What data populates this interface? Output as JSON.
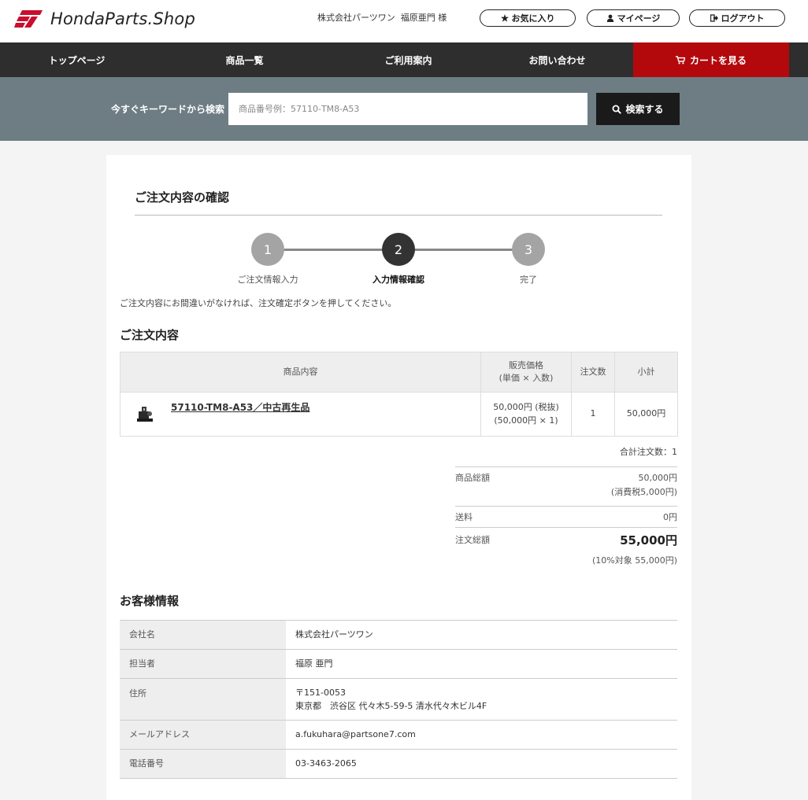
{
  "header": {
    "logo_text": "HondaParts.Shop",
    "user_company": "株式会社パーツワン",
    "user_name": "福原亜門",
    "user_suffix": "様",
    "favorites_label": "お気に入り",
    "mypage_label": "マイページ",
    "logout_label": "ログアウト"
  },
  "nav": {
    "items": [
      "トップページ",
      "商品一覧",
      "ご利用案内",
      "お問い合わせ"
    ],
    "cart_label": "カートを見る"
  },
  "search": {
    "label": "今すぐキーワードから検索",
    "placeholder": "商品番号例：57110-TM8-A53",
    "button_label": "検索する"
  },
  "page": {
    "title": "ご注文内容の確認",
    "instruction": "ご注文内容にお間違いがなければ、注文確定ボタンを押してください。"
  },
  "steps": [
    {
      "number": "1",
      "label": "ご注文情報入力",
      "state": "done"
    },
    {
      "number": "2",
      "label": "入力情報確認",
      "state": "current"
    },
    {
      "number": "3",
      "label": "完了",
      "state": "pending"
    }
  ],
  "order": {
    "section_title": "ご注文内容",
    "headers": {
      "product": "商品内容",
      "price_line1": "販売価格",
      "price_line2": "(単価 × 入数)",
      "qty": "注文数",
      "subtotal": "小計"
    },
    "rows": [
      {
        "product_name": "57110-TM8-A53／中古再生品",
        "price_line1": "50,000円 (税抜)",
        "price_line2": "(50,000円 × 1)",
        "qty": "1",
        "subtotal": "50,000円"
      }
    ],
    "total_qty": "合計注文数：1",
    "summary": {
      "goods_label": "商品総額",
      "goods_value": "50,000円",
      "goods_tax": "(消費税5,000円)",
      "shipping_label": "送料",
      "shipping_value": "0円",
      "total_label": "注文総額",
      "total_value": "55,000円",
      "total_tax": "(10%対象 55,000円)"
    }
  },
  "customer": {
    "section_title": "お客様情報",
    "rows": [
      {
        "label": "会社名",
        "value": "株式会社パーツワン"
      },
      {
        "label": "担当者",
        "value": "福原 亜門"
      },
      {
        "label": "住所",
        "value": "〒151-0053",
        "value2": "東京都　渋谷区 代々木5-59-5 清水代々木ビル4F"
      },
      {
        "label": "メールアドレス",
        "value": "a.fukuhara@partsone7.com"
      },
      {
        "label": "電話番号",
        "value": "03-3463-2065"
      }
    ]
  },
  "next_section_title": "",
  "colors": {
    "nav_bg": "#2e2e2e",
    "cart_red": "#b3090d",
    "search_bg": "#6e7d84",
    "logo_red": "#c8102e"
  },
  "icons": {
    "favorites": "star-icon",
    "mypage": "user-icon",
    "logout": "sign-out-icon",
    "cart": "cart-icon",
    "search": "search-icon"
  }
}
